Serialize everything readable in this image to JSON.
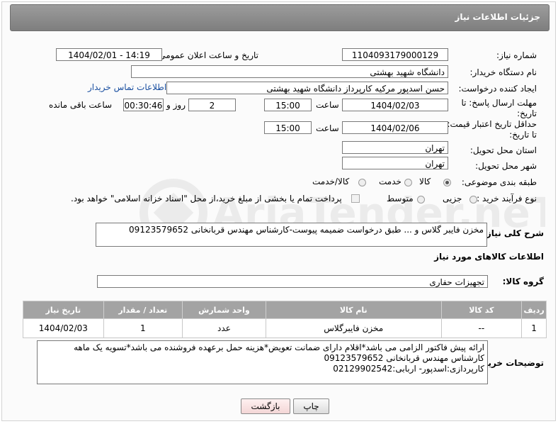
{
  "header": {
    "title": "جزئیات اطلاعات نیاز"
  },
  "form": {
    "need_number_label": "شماره نیاز:",
    "need_number": "1104093179000129",
    "announce_label": "تاریخ و ساعت اعلان عمومی:",
    "announce_value": "1404/02/01 - 14:19",
    "buyer_org_label": "نام دستگاه خریدار:",
    "buyer_org": "دانشگاه شهید بهشتی",
    "creator_label": "ایجاد کننده درخواست:",
    "creator": "حسن اسدپور مرکیه کارپرداز دانشگاه شهید بهشتی",
    "contact_link": "اطلاعات تماس خریدار",
    "deadline_label_1": "مهلت ارسال پاسخ: تا",
    "deadline_label_2": "تاریخ:",
    "deadline_date": "1404/02/03",
    "time_label": "ساعت",
    "deadline_time": "15:00",
    "days_value": "2",
    "days_label": "روز و",
    "remaining_value": "00:30:46",
    "remaining_label": "ساعت باقی مانده",
    "validity_label_1": "حداقل تاریخ اعتبار قیمت:",
    "validity_label_2": "تا تاریخ:",
    "validity_date": "1404/02/06",
    "validity_time_label": "ساعت",
    "validity_time": "15:00",
    "province_label": "استان محل تحویل:",
    "province": "تهران",
    "city_label": "شهر محل تحویل:",
    "city": "تهران",
    "category_label": "طبقه بندی موضوعی:",
    "category_options": [
      "کالا",
      "خدمت",
      "کالا/خدمت"
    ],
    "process_label": "نوع فرآیند خرید :",
    "process_options": [
      "جزیی",
      "متوسط"
    ],
    "payment_note": "پرداخت تمام یا بخشی از مبلغ خرید،از محل \"اسناد خزانه اسلامی\" خواهد بود."
  },
  "description": {
    "label": "شرح کلی نیاز:",
    "value": "مخزن فایبر گلاس و ... طبق درخواست ضمیمه پیوست-کارشناس مهندس قربانخانی 09123579652"
  },
  "goods": {
    "section_title": "اطلاعات کالاهای مورد نیاز",
    "group_label": "گروه کالا:",
    "group_value": "تجهیزات حفاری",
    "columns": [
      "ردیف",
      "کد کالا",
      "نام کالا",
      "واحد شمارش",
      "تعداد / مقدار",
      "تاریخ نیاز"
    ],
    "rows": [
      [
        "1",
        "--",
        "مخزن فایبرگلاس",
        "عدد",
        "1",
        "1404/02/03"
      ]
    ]
  },
  "notes": {
    "label": "توضیحات خریدار:",
    "lines": [
      "ارائه پیش فاکتور الزامی می باشد*اقلام دارای ضمانت تعویض*هزینه حمل برعهده فروشنده می باشد*تسویه یک ماهه",
      "کارشناس مهندس قربانخانی 09123579652",
      "کارپردازی:اسدپور- اربابی:02129902542"
    ]
  },
  "buttons": {
    "print": "چاپ",
    "back": "بازگشت"
  },
  "watermark": {
    "text": "AriaTender.neT"
  }
}
